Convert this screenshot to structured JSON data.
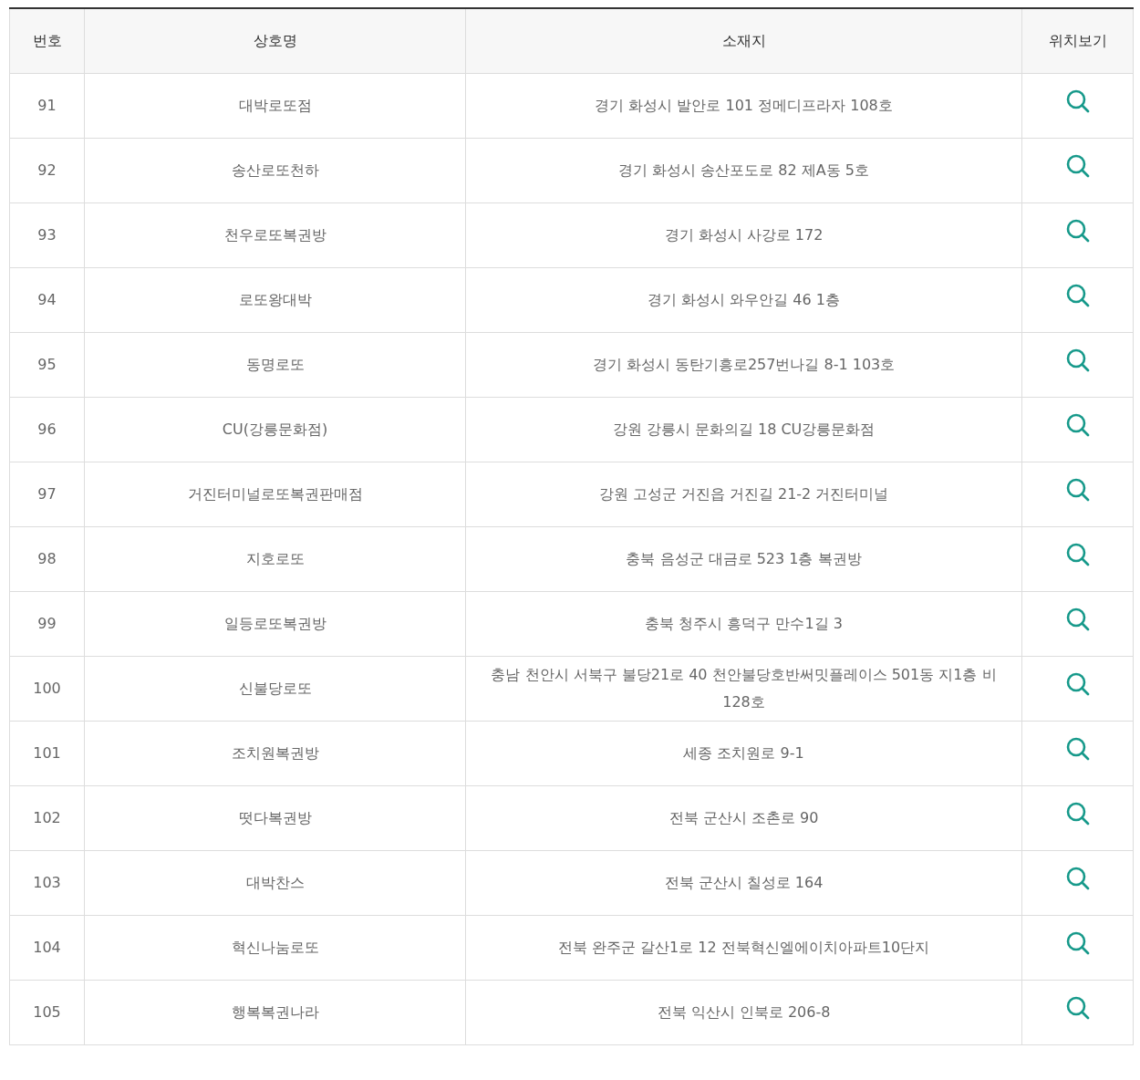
{
  "table": {
    "columns": [
      "번호",
      "상호명",
      "소재지",
      "위치보기"
    ],
    "rows": [
      {
        "number": "91",
        "name": "대박로또점",
        "address": "경기 화성시 발안로 101 정메디프라자 108호"
      },
      {
        "number": "92",
        "name": "송산로또천하",
        "address": "경기 화성시 송산포도로 82 제A동 5호"
      },
      {
        "number": "93",
        "name": "천우로또복권방",
        "address": "경기 화성시 사강로 172"
      },
      {
        "number": "94",
        "name": "로또왕대박",
        "address": "경기 화성시 와우안길 46 1층"
      },
      {
        "number": "95",
        "name": "동명로또",
        "address": "경기 화성시 동탄기흥로257번나길 8-1 103호"
      },
      {
        "number": "96",
        "name": "CU(강릉문화점)",
        "address": "강원 강릉시 문화의길 18 CU강릉문화점"
      },
      {
        "number": "97",
        "name": "거진터미널로또복권판매점",
        "address": "강원 고성군 거진읍 거진길 21-2 거진터미널"
      },
      {
        "number": "98",
        "name": "지호로또",
        "address": "충북 음성군 대금로 523 1층 복권방"
      },
      {
        "number": "99",
        "name": "일등로또복권방",
        "address": "충북 청주시 흥덕구 만수1길 3"
      },
      {
        "number": "100",
        "name": "신불당로또",
        "address": "충남 천안시 서북구 불당21로 40 천안불당호반써밋플레이스 501동 지1층 비128호"
      },
      {
        "number": "101",
        "name": "조치원복권방",
        "address": "세종 조치원로 9-1"
      },
      {
        "number": "102",
        "name": "떳다복권방",
        "address": "전북 군산시 조촌로 90"
      },
      {
        "number": "103",
        "name": "대박찬스",
        "address": "전북 군산시 칠성로 164"
      },
      {
        "number": "104",
        "name": "혁신나눔로또",
        "address": "전북 완주군 갈산1로 12 전북혁신엘에이치아파트10단지"
      },
      {
        "number": "105",
        "name": "행복복권나라",
        "address": "전북 익산시 인북로 206-8"
      }
    ]
  }
}
